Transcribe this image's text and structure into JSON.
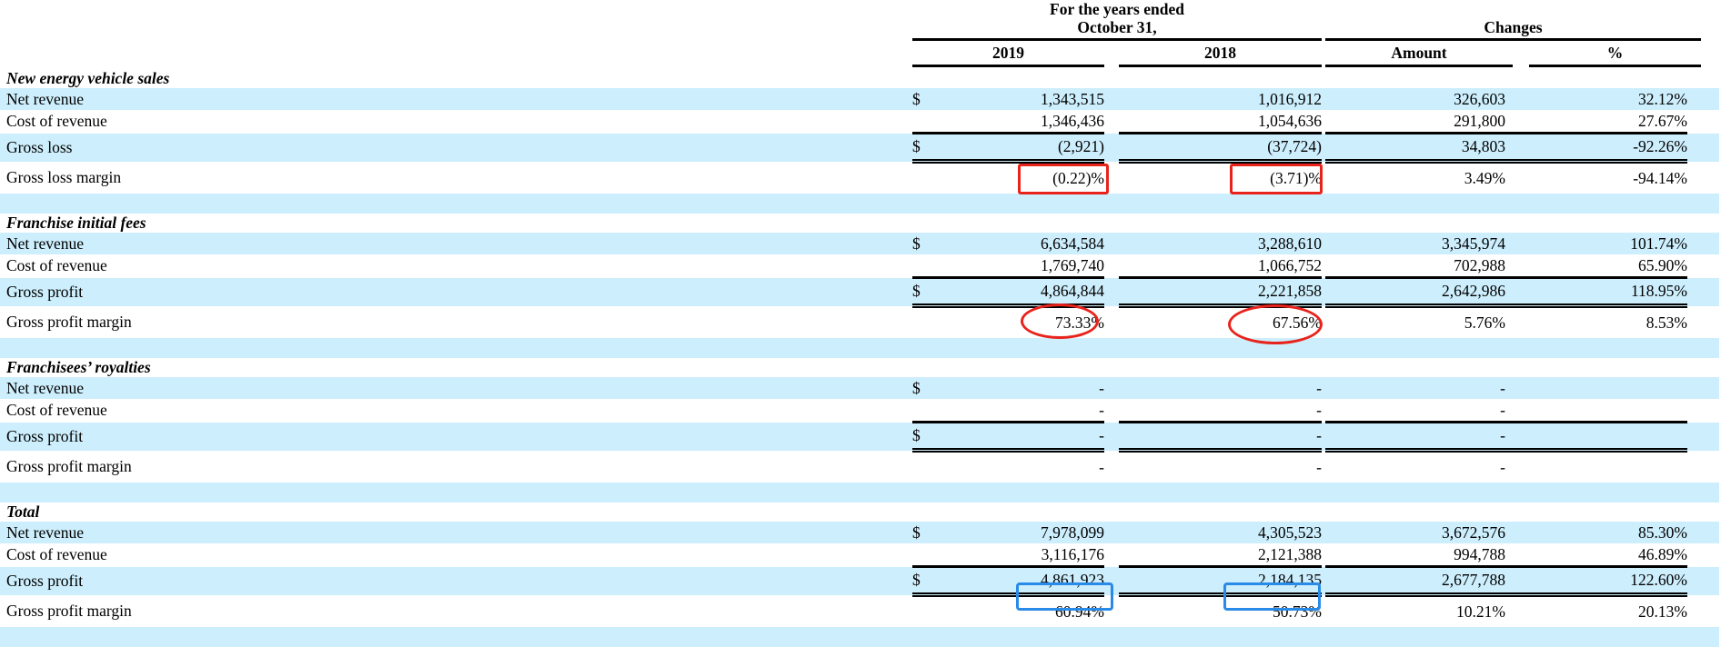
{
  "header": {
    "period_line1": "For the years ended",
    "period_line2": "October 31,",
    "changes": "Changes",
    "col_2019": "2019",
    "col_2018": "2018",
    "col_amount": "Amount",
    "col_pct": "%"
  },
  "groups": [
    {
      "title": "New energy vehicle sales",
      "rows": [
        {
          "label": "Net revenue",
          "dollar": "$",
          "v2019": "1,343,515",
          "v2018": "1,016,912",
          "amount": "326,603",
          "pct": "32.12%"
        },
        {
          "label": "Cost of revenue",
          "dollar": "",
          "v2019": "1,346,436",
          "v2018": "1,054,636",
          "amount": "291,800",
          "pct": "27.67%"
        },
        {
          "label": "Gross loss",
          "dollar": "$",
          "v2019": "(2,921)",
          "v2018": "(37,724)",
          "amount": "34,803",
          "pct": "-92.26%"
        },
        {
          "label": "Gross loss margin",
          "dollar": "",
          "v2019": "(0.22)%",
          "v2018": "(3.71)%",
          "amount": "3.49%",
          "pct": "-94.14%"
        }
      ]
    },
    {
      "title": "Franchise initial fees",
      "rows": [
        {
          "label": "Net revenue",
          "dollar": "$",
          "v2019": "6,634,584",
          "v2018": "3,288,610",
          "amount": "3,345,974",
          "pct": "101.74%"
        },
        {
          "label": "Cost of revenue",
          "dollar": "",
          "v2019": "1,769,740",
          "v2018": "1,066,752",
          "amount": "702,988",
          "pct": "65.90%"
        },
        {
          "label": "Gross profit",
          "dollar": "$",
          "v2019": "4,864,844",
          "v2018": "2,221,858",
          "amount": "2,642,986",
          "pct": "118.95%"
        },
        {
          "label": "Gross profit margin",
          "dollar": "",
          "v2019": "73.33%",
          "v2018": "67.56%",
          "amount": "5.76%",
          "pct": "8.53%"
        }
      ]
    },
    {
      "title": "Franchisees’ royalties",
      "rows": [
        {
          "label": "Net revenue",
          "dollar": "$",
          "v2019": "-",
          "v2018": "-",
          "amount": "-",
          "pct": ""
        },
        {
          "label": "Cost of revenue",
          "dollar": "",
          "v2019": "-",
          "v2018": "-",
          "amount": "-",
          "pct": ""
        },
        {
          "label": "Gross profit",
          "dollar": "$",
          "v2019": "-",
          "v2018": "-",
          "amount": "-",
          "pct": ""
        },
        {
          "label": "Gross profit margin",
          "dollar": "",
          "v2019": "-",
          "v2018": "-",
          "amount": "-",
          "pct": ""
        }
      ]
    },
    {
      "title": "Total",
      "rows": [
        {
          "label": "Net revenue",
          "dollar": "$",
          "v2019": "7,978,099",
          "v2018": "4,305,523",
          "amount": "3,672,576",
          "pct": "85.30%"
        },
        {
          "label": "Cost of revenue",
          "dollar": "",
          "v2019": "3,116,176",
          "v2018": "2,121,388",
          "amount": "994,788",
          "pct": "46.89%"
        },
        {
          "label": "Gross profit",
          "dollar": "$",
          "v2019": "4,861,923",
          "v2018": "2,184,135",
          "amount": "2,677,788",
          "pct": "122.60%"
        },
        {
          "label": "Gross profit margin",
          "dollar": "",
          "v2019": "60.94%",
          "v2018": "50.73%",
          "amount": "10.21%",
          "pct": "20.13%"
        }
      ]
    }
  ],
  "annotation_colors": {
    "red": "#e8231b",
    "blue": "#2a8ae8"
  }
}
